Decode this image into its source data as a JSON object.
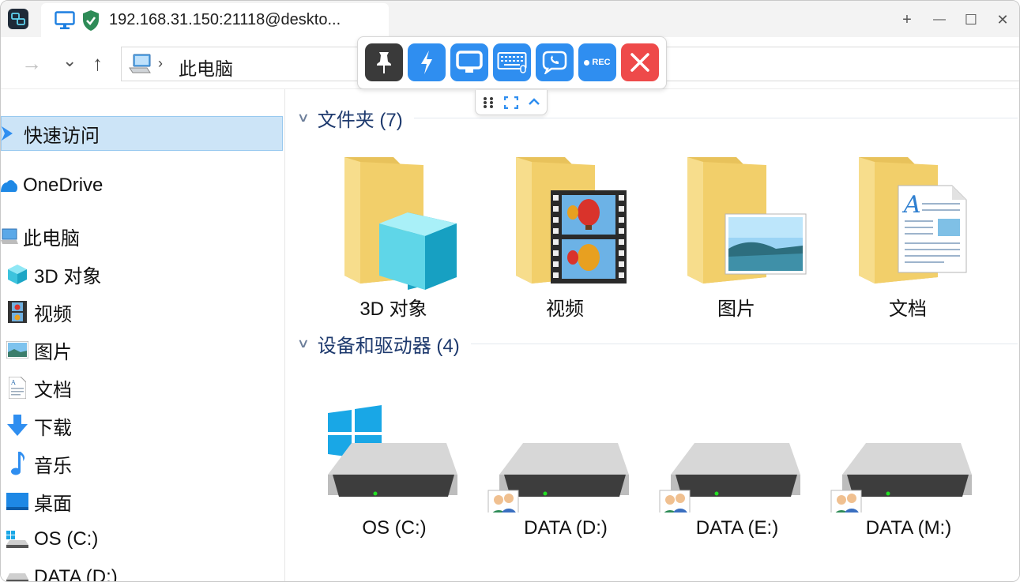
{
  "tab": {
    "title": "192.168.31.150:21118@deskto..."
  },
  "window_controls": {
    "new_tab": "+",
    "minimize": "—",
    "maximize": "☐",
    "close": "✕"
  },
  "nav": {
    "back": "→",
    "recent": "⌄",
    "up": "↑"
  },
  "address": {
    "separator": "›",
    "path": "此电脑"
  },
  "remote_toolbar": {
    "buttons": [
      {
        "name": "pin",
        "icon": "pin-icon",
        "color": "#3a3a3a"
      },
      {
        "name": "lightning",
        "icon": "lightning-icon",
        "color": "#2f8ef0"
      },
      {
        "name": "display",
        "icon": "monitor-icon",
        "color": "#2f8ef0"
      },
      {
        "name": "keyboard",
        "icon": "keyboard-icon",
        "color": "#2f8ef0"
      },
      {
        "name": "chat",
        "icon": "chat-icon",
        "color": "#2f8ef0"
      },
      {
        "name": "record",
        "icon": "record-icon",
        "color": "#2f8ef0",
        "label": "REC"
      },
      {
        "name": "disconnect",
        "icon": "close-icon",
        "color": "#ee4a4a"
      }
    ]
  },
  "sidebar": {
    "items": [
      {
        "label": "快速访问",
        "icon": "star-icon",
        "selected": true
      },
      {
        "label": "OneDrive",
        "icon": "cloud-icon"
      },
      {
        "label": "此电脑",
        "icon": "computer-icon"
      },
      {
        "label": "3D 对象",
        "icon": "cube-icon"
      },
      {
        "label": "视频",
        "icon": "film-icon"
      },
      {
        "label": "图片",
        "icon": "picture-icon"
      },
      {
        "label": "文档",
        "icon": "document-icon"
      },
      {
        "label": "下载",
        "icon": "download-icon"
      },
      {
        "label": "音乐",
        "icon": "music-icon"
      },
      {
        "label": "桌面",
        "icon": "desktop-icon"
      },
      {
        "label": "OS (C:)",
        "icon": "drive-icon"
      },
      {
        "label": "DATA (D:)",
        "icon": "network-drive-icon"
      }
    ]
  },
  "folders_group": {
    "title": "文件夹 (7)",
    "items": [
      {
        "label": "3D 对象",
        "icon": "cube-folder-icon"
      },
      {
        "label": "视频",
        "icon": "video-folder-icon"
      },
      {
        "label": "图片",
        "icon": "pictures-folder-icon"
      },
      {
        "label": "文档",
        "icon": "documents-folder-icon"
      }
    ]
  },
  "drives_group": {
    "title": "设备和驱动器 (4)",
    "items": [
      {
        "label": "OS (C:)",
        "icon": "windows-drive-icon"
      },
      {
        "label": "DATA (D:)",
        "icon": "shared-drive-icon"
      },
      {
        "label": "DATA (E:)",
        "icon": "shared-drive-icon"
      },
      {
        "label": "DATA (M:)",
        "icon": "shared-drive-icon"
      }
    ]
  }
}
